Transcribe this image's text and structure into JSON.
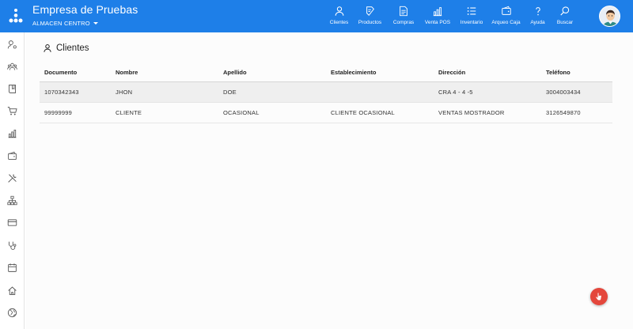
{
  "header": {
    "company": "Empresa de Pruebas",
    "store": "ALMACEN CENTRO",
    "colors": {
      "bar": "#1e7fe8",
      "fab": "#e4473c"
    },
    "nav": [
      {
        "label": "Clientes",
        "icon": "user-icon"
      },
      {
        "label": "Productos",
        "icon": "products-icon"
      },
      {
        "label": "Compras",
        "icon": "purchases-icon"
      },
      {
        "label": "Venta POS",
        "icon": "pos-chart-icon"
      },
      {
        "label": "Inventario",
        "icon": "list-icon"
      },
      {
        "label": "Arqueo Caja",
        "icon": "wallet-icon"
      },
      {
        "label": "Ayuda",
        "icon": "help-icon"
      },
      {
        "label": "Buscar",
        "icon": "search-icon"
      }
    ]
  },
  "sidebar": {
    "items": [
      {
        "icon": "user-settings-icon"
      },
      {
        "icon": "users-icon"
      },
      {
        "icon": "book-icon"
      },
      {
        "icon": "cart-icon"
      },
      {
        "icon": "chart-icon"
      },
      {
        "icon": "wallet-icon"
      },
      {
        "icon": "tools-icon"
      },
      {
        "icon": "hierarchy-icon"
      },
      {
        "icon": "card-icon"
      },
      {
        "icon": "stethoscope-icon"
      },
      {
        "icon": "calendar-icon"
      },
      {
        "icon": "home-icon"
      },
      {
        "icon": "globe-icon"
      }
    ]
  },
  "page": {
    "title": "Clientes",
    "columns": [
      "Documento",
      "Nombre",
      "Apellido",
      "Establecimiento",
      "Dirección",
      "Teléfono"
    ],
    "rows": [
      [
        "1070342343",
        "JHON",
        "DOE",
        "",
        "CRA 4 - 4 -5",
        "3004003434"
      ],
      [
        "99999999",
        "CLIENTE",
        "OCASIONAL",
        "CLIENTE OCASIONAL",
        "VENTAS MOSTRADOR",
        "3126549870"
      ]
    ]
  }
}
